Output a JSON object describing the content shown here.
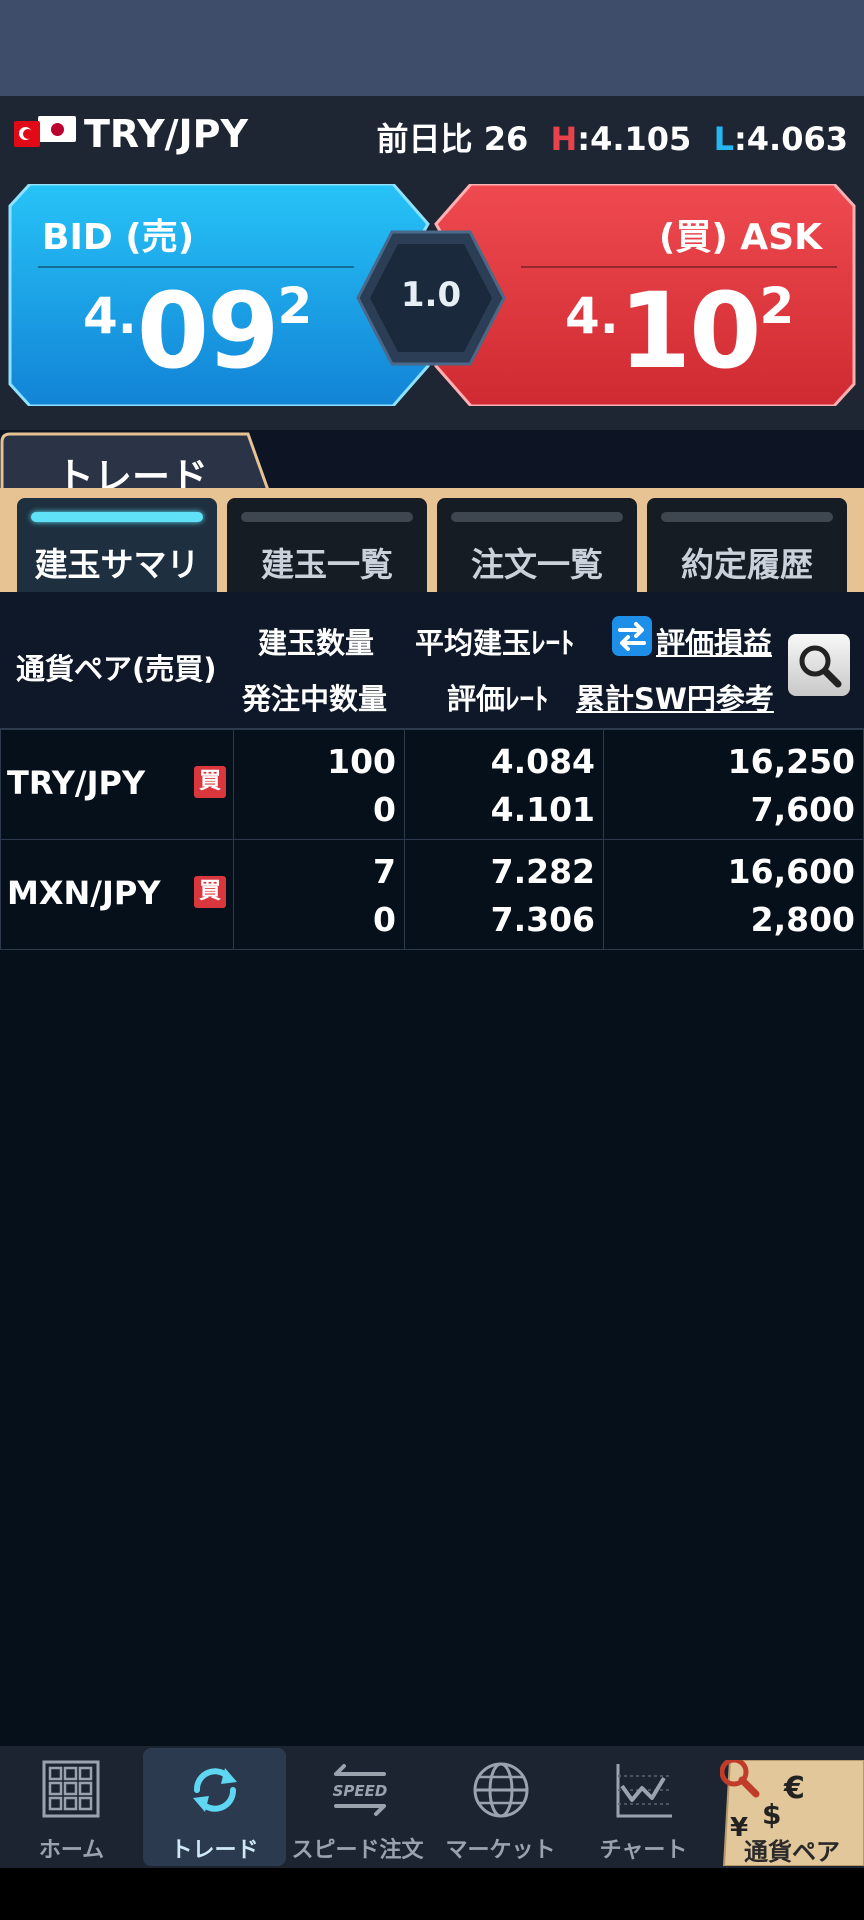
{
  "header": {
    "pair": "TRY/JPY",
    "change_label": "前日比",
    "change_value": "26",
    "high_label": "H",
    "high_value": ":4.105",
    "low_label": "L",
    "low_value": ":4.063"
  },
  "quote": {
    "bid_label": "BID (売)",
    "bid_big1": "4.",
    "bid_big2": "09",
    "bid_small": "2",
    "ask_label": "(買) ASK",
    "ask_big1": "4.",
    "ask_big2": "10",
    "ask_small": "2",
    "spread": "1.0",
    "bid_color": "#1da6ea",
    "ask_color": "#e2373d"
  },
  "trade_tab": "トレード",
  "subtabs": [
    "建玉サマリ",
    "建玉一覧",
    "注文一覧",
    "約定履歴"
  ],
  "columns": {
    "pair": "通貨ペア(売買)",
    "qty": "建玉数量",
    "pending_qty": "発注中数量",
    "avg_rate": "平均建玉ﾚｰﾄ",
    "eval_rate": "評価ﾚｰﾄ",
    "pl": "評価損益",
    "swap": "累計SW円参考"
  },
  "positions": [
    {
      "pair": "TRY/JPY",
      "side": "買",
      "qty": "100",
      "pending": "0",
      "avg_rate": "4.084",
      "eval_rate": "4.101",
      "pl": "16,250",
      "swap": "7,600"
    },
    {
      "pair": "MXN/JPY",
      "side": "買",
      "qty": "7",
      "pending": "0",
      "avg_rate": "7.282",
      "eval_rate": "7.306",
      "pl": "16,600",
      "swap": "2,800"
    }
  ],
  "nav": [
    "ホーム",
    "トレード",
    "スピード注文",
    "マーケット",
    "チャート",
    "通貨ペア"
  ],
  "nav_speed_text": "SPEED",
  "currency_symbols": {
    "euro": "€",
    "dollar": "$",
    "yen": "¥"
  }
}
